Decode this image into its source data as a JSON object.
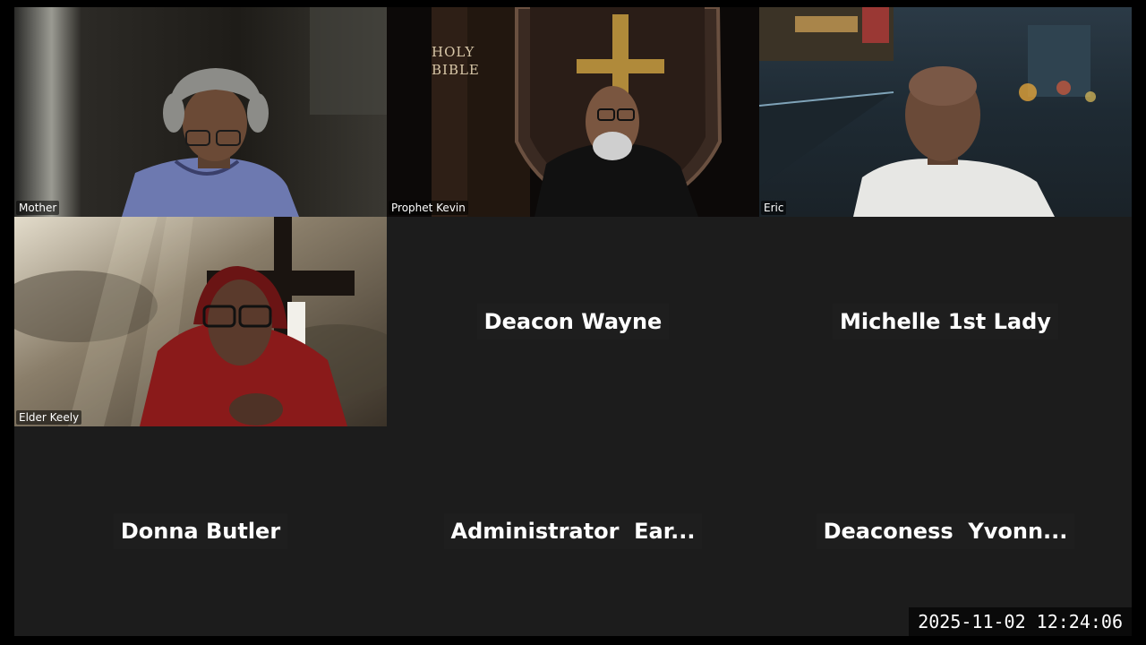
{
  "participants_video": [
    {
      "name": "Mother"
    },
    {
      "name": "Prophet Kevin"
    },
    {
      "name": "Eric"
    },
    {
      "name": "Elder Keely"
    }
  ],
  "participants_audio": [
    {
      "name": "Deacon Wayne"
    },
    {
      "name": "Michelle 1st Lady"
    },
    {
      "name": "Donna Butler"
    },
    {
      "name": "Administrator  Ear..."
    },
    {
      "name": "Deaconess  Yvonn..."
    }
  ],
  "backgrounds": {
    "bible_text": "HOLY\nBIBLE"
  },
  "timestamp": "2025-11-02  12:24:06",
  "colors": {
    "tile_bg": "#1c1c1c",
    "stage_bg": "#1b1b1b",
    "cross_gold": "#b08a3a",
    "robe_red": "#8a1a1a"
  }
}
